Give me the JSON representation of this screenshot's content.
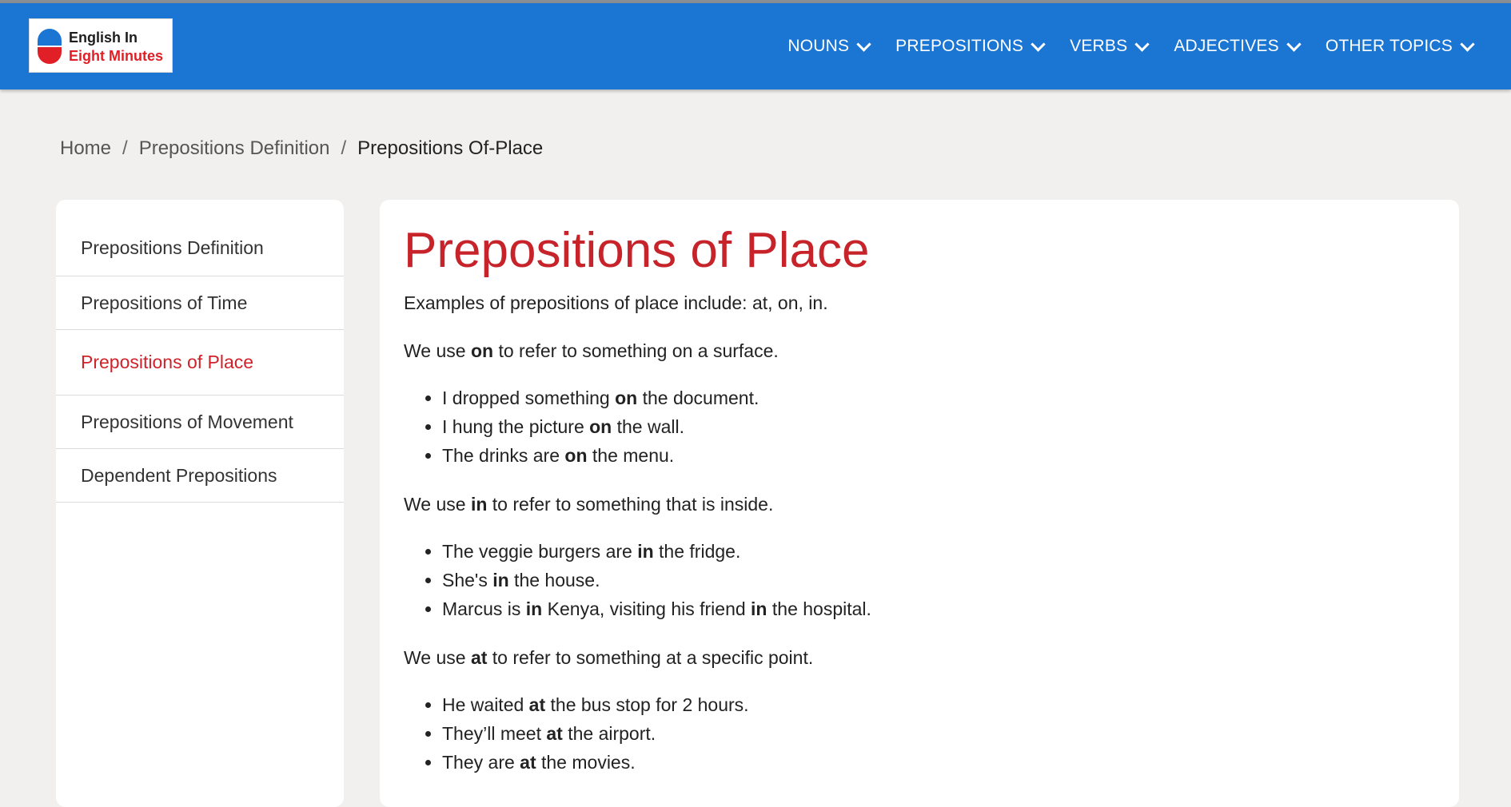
{
  "brand": {
    "logo_line1": "English In",
    "logo_line2": "Eight Minutes",
    "colors": {
      "header_bg": "#1b76d3",
      "accent_red": "#c7232a"
    }
  },
  "nav": [
    {
      "label": "NOUNS",
      "icon": "chevron-down-icon"
    },
    {
      "label": "PREPOSITIONS",
      "icon": "chevron-down-icon"
    },
    {
      "label": "VERBS",
      "icon": "chevron-down-icon"
    },
    {
      "label": "ADJECTIVES",
      "icon": "chevron-down-icon"
    },
    {
      "label": "OTHER TOPICS",
      "icon": "chevron-down-icon"
    }
  ],
  "breadcrumb": {
    "home": "Home",
    "section": "Prepositions Definition",
    "current": "Prepositions Of-Place",
    "separator": "/"
  },
  "sidebar": {
    "items": [
      {
        "label": "Prepositions Definition"
      },
      {
        "label": "Prepositions of Time"
      },
      {
        "label": "Prepositions of Place",
        "active": true
      },
      {
        "label": "Prepositions of Movement"
      },
      {
        "label": "Dependent Prepositions"
      }
    ]
  },
  "article": {
    "title": "Prepositions of Place",
    "intro": "Examples of prepositions of place include: at, on, in.",
    "sections": [
      {
        "rule": {
          "pre": "We use ",
          "bold": "on",
          "post": " to refer to something on a surface."
        },
        "examples": [
          {
            "pre": "I dropped something ",
            "bold": "on",
            "post": " the document."
          },
          {
            "pre": "I hung the picture ",
            "bold": "on",
            "post": " the wall."
          },
          {
            "pre": "The drinks are ",
            "bold": "on",
            "post": " the menu."
          }
        ]
      },
      {
        "rule": {
          "pre": "We use ",
          "bold": "in",
          "post": " to refer to something that is inside."
        },
        "examples": [
          {
            "pre": "The veggie burgers are ",
            "bold": "in",
            "post": " the fridge."
          },
          {
            "pre": "She's ",
            "bold": "in",
            "post": " the house."
          },
          {
            "pre": "Marcus is ",
            "bold": "in",
            "mid": " Kenya, visiting his friend ",
            "bold2": "in",
            "post": " the hospital."
          }
        ]
      },
      {
        "rule": {
          "pre": "We use ",
          "bold": "at",
          "post": " to refer to something at a specific point."
        },
        "examples": [
          {
            "pre": "He waited ",
            "bold": "at",
            "post": " the bus stop for 2 hours."
          },
          {
            "pre": "They’ll meet ",
            "bold": "at",
            "post": " the airport."
          },
          {
            "pre": "They are ",
            "bold": "at",
            "post": " the movies."
          }
        ]
      }
    ]
  }
}
